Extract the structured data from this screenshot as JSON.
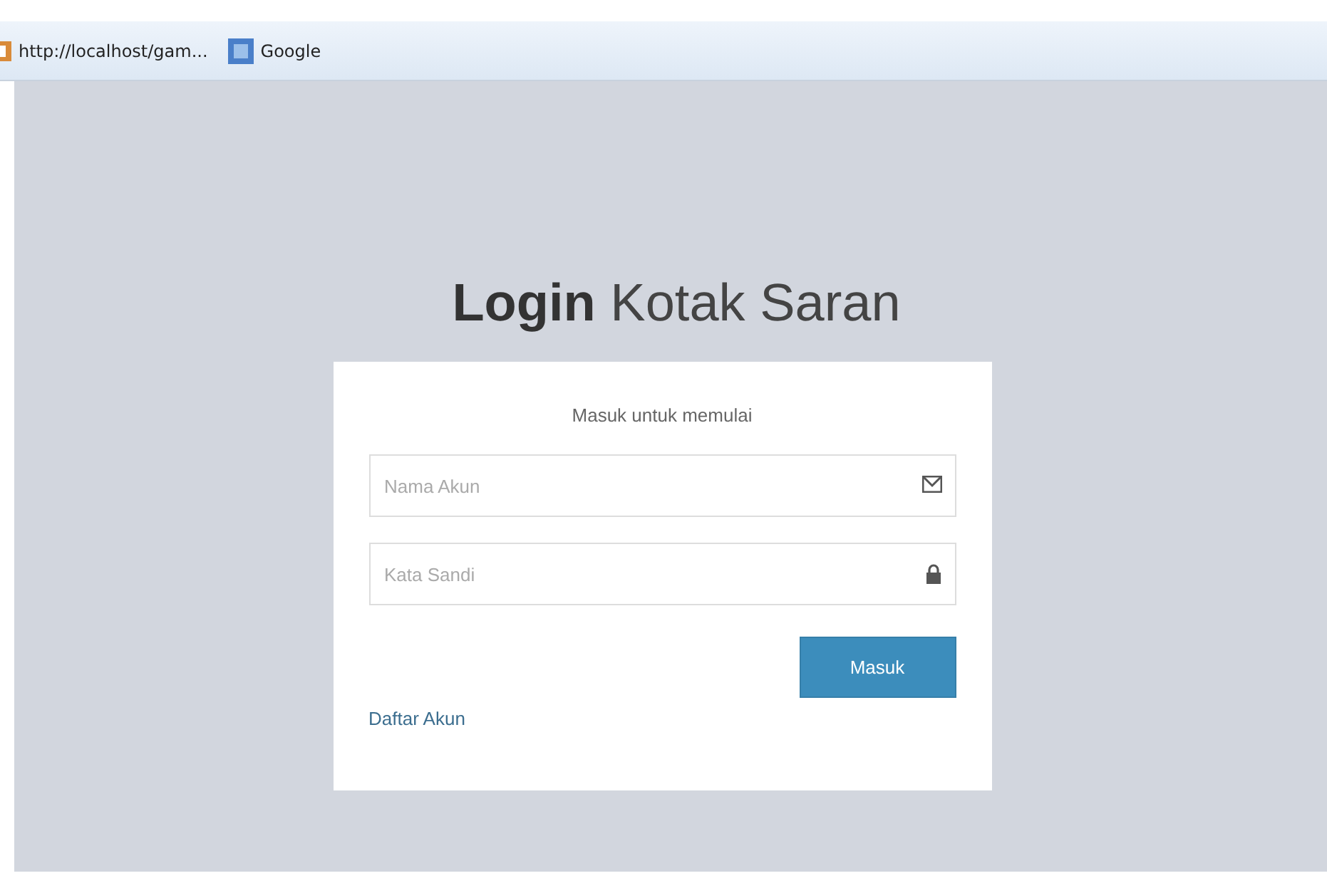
{
  "bookmarks_bar": {
    "items": [
      {
        "kind": "page",
        "label": "http://localhost/gam..."
      },
      {
        "kind": "google",
        "label": "Google"
      }
    ]
  },
  "login": {
    "title_bold": "Login",
    "title_rest": "Kotak Saran",
    "message": "Masuk untuk memulai",
    "fields": [
      {
        "kind": "user",
        "placeholder": "Nama Akun"
      },
      {
        "kind": "password",
        "placeholder": "Kata Sandi"
      }
    ],
    "submit": "Masuk",
    "register_link": "Daftar Akun"
  }
}
